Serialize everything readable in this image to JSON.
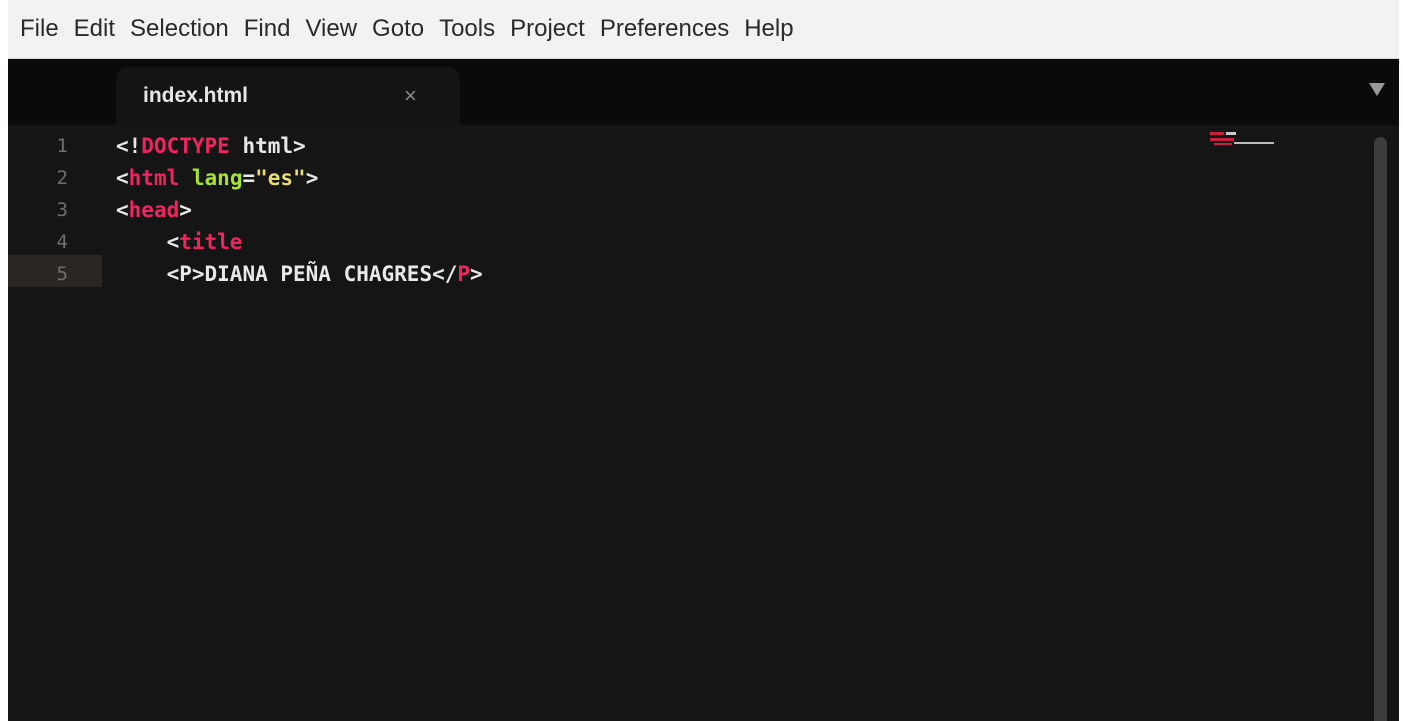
{
  "menubar": {
    "items": [
      "File",
      "Edit",
      "Selection",
      "Find",
      "View",
      "Goto",
      "Tools",
      "Project",
      "Preferences",
      "Help"
    ]
  },
  "tabbar": {
    "active_tab": {
      "title": "index.html",
      "close_glyph": "×"
    },
    "nav_icons": [
      "arrow-left-icon",
      "arrow-right-icon"
    ],
    "dropdown_icon": "triangle-down-icon"
  },
  "editor": {
    "line_numbers": [
      "1",
      "2",
      "3",
      "4",
      "5"
    ],
    "current_line": "5",
    "lines": [
      [
        {
          "t": "<!",
          "c": "punct"
        },
        {
          "t": "DOCTYPE",
          "c": "tag"
        },
        {
          "t": " html>",
          "c": "punct"
        }
      ],
      [
        {
          "t": "<",
          "c": "punct"
        },
        {
          "t": "html",
          "c": "tag"
        },
        {
          "t": " ",
          "c": "punct"
        },
        {
          "t": "lang",
          "c": "attr"
        },
        {
          "t": "=",
          "c": "punct"
        },
        {
          "t": "\"es\"",
          "c": "str"
        },
        {
          "t": ">",
          "c": "punct"
        }
      ],
      [
        {
          "t": "<",
          "c": "punct"
        },
        {
          "t": "head",
          "c": "tag"
        },
        {
          "t": ">",
          "c": "punct"
        }
      ],
      [
        {
          "t": "    <",
          "c": "punct"
        },
        {
          "t": "title",
          "c": "tag"
        }
      ],
      [
        {
          "t": "    <P>",
          "c": "punct"
        },
        {
          "t": "DIANA PEÑA CHAGRES",
          "c": "txt"
        },
        {
          "t": "</",
          "c": "punct"
        },
        {
          "t": "P",
          "c": "tag"
        },
        {
          "t": ">",
          "c": "punct"
        }
      ]
    ]
  },
  "colors": {
    "tag": "#f0245f",
    "attribute": "#a6e22e",
    "string": "#e6db74",
    "text": "#e8e8e8",
    "background": "#151515"
  }
}
